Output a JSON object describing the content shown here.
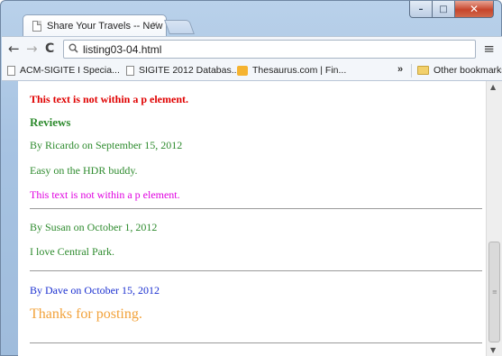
{
  "window": {
    "caption_min": "–",
    "caption_max": "□",
    "caption_close": "✕"
  },
  "tab": {
    "title": "Share Your Travels -- New",
    "close": "×"
  },
  "toolbar": {
    "back": "←",
    "forward": "→",
    "reload": "C",
    "url": "listing03-04.html",
    "menu": "≡"
  },
  "bookmarks": {
    "items": [
      {
        "label": "ACM-SIGITE I Specia...",
        "icon": "page-icon"
      },
      {
        "label": "SIGITE 2012 Databas...",
        "icon": "page-icon"
      },
      {
        "label": "Thesaurus.com | Fin...",
        "icon": "thesaurus-icon"
      }
    ],
    "overflow": "»",
    "other": "Other bookmarks"
  },
  "content": {
    "red_text": "This text is not within a p element.",
    "reviews_heading": "Reviews",
    "review1_by": "By Ricardo on September 15, 2012",
    "review1_text": "Easy on the HDR buddy.",
    "magenta_text": "This text is not within a p element.",
    "review2_by": "By Susan on October 1, 2012",
    "review2_text": "I love Central Park.",
    "review3_by": "By Dave on October 15, 2012",
    "review3_text": "Thanks for posting.",
    "colors": {
      "red": "#e00000",
      "green": "#2e8b2e",
      "magenta": "#e000e0",
      "blue": "#1a2fd0",
      "orange": "#f2a23a"
    }
  },
  "scrollbar": {
    "up": "▲",
    "down": "▼",
    "grip": "≡"
  }
}
